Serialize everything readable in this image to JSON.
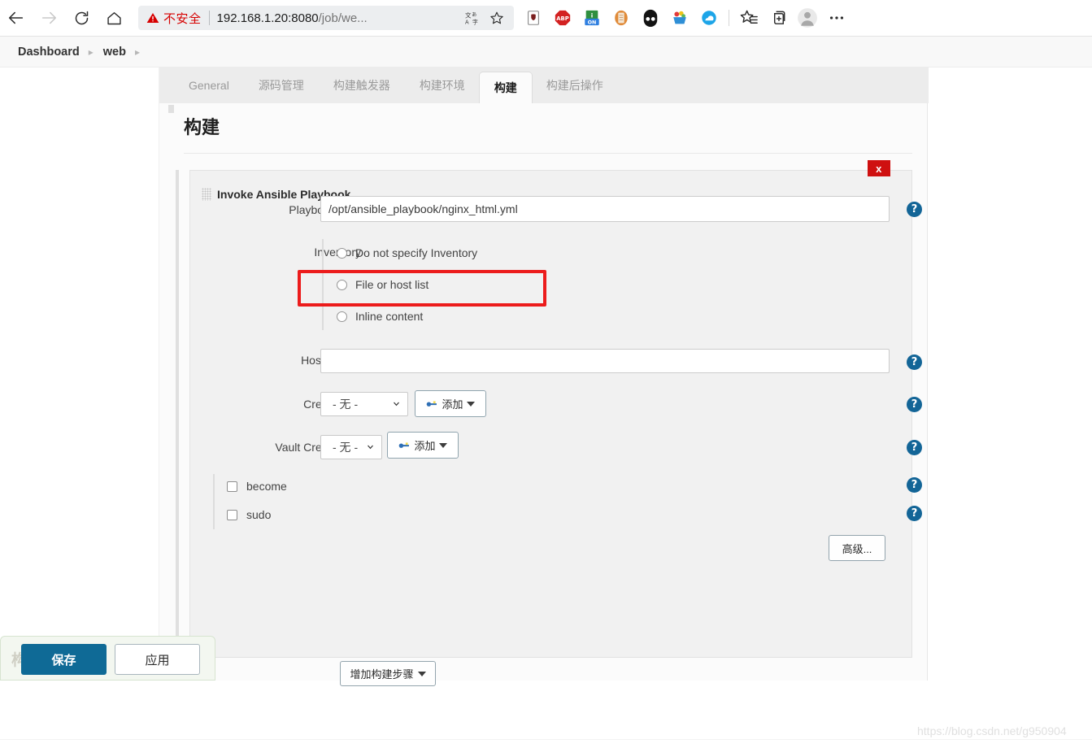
{
  "browser": {
    "back_icon": "arrow-left-icon",
    "forward_icon": "arrow-right-icon",
    "reload_icon": "reload-icon",
    "home_icon": "home-icon",
    "security_warning_icon": "warning-triangle-icon",
    "security_label": "不安全",
    "url_main": "192.168.1.20:8080",
    "url_path": "/job/we...",
    "translate_icon": "translate-icon",
    "favorite_icon": "star-icon",
    "extensions": [
      {
        "name": "shield-extension-icon",
        "title": "uBlock"
      },
      {
        "name": "abp-extension-icon",
        "title": "ABP"
      },
      {
        "name": "noscript-extension-icon",
        "title": "ON"
      },
      {
        "name": "document-extension-icon",
        "title": "Doc"
      },
      {
        "name": "panda-extension-icon",
        "title": "Panda"
      },
      {
        "name": "basket-extension-icon",
        "title": "Basket"
      },
      {
        "name": "cloud-extension-icon",
        "title": "OneDrive"
      }
    ],
    "collections_icon": "collections-icon",
    "add-tab_icon": "tab-add-icon",
    "profile_icon": "profile-avatar-icon",
    "more_icon": "more-ellipsis-icon"
  },
  "breadcrumb": {
    "items": [
      "Dashboard",
      "web"
    ],
    "separator": "▸"
  },
  "tabs": [
    {
      "label": "General",
      "active": false
    },
    {
      "label": "源码管理",
      "active": false
    },
    {
      "label": "构建触发器",
      "active": false
    },
    {
      "label": "构建环境",
      "active": false
    },
    {
      "label": "构建",
      "active": true
    },
    {
      "label": "构建后操作",
      "active": false
    }
  ],
  "section": {
    "title": "构建"
  },
  "builder": {
    "title": "Invoke Ansible Playbook",
    "close_label": "x",
    "help_label": "?",
    "playbook": {
      "label": "Playbook path",
      "value": "/opt/ansible_playbook/nginx_html.yml",
      "placeholder": ""
    },
    "inventory": {
      "label": "Inventory",
      "options": [
        {
          "label": "Do not specify Inventory",
          "checked": false
        },
        {
          "label": "File or host list",
          "checked": false
        },
        {
          "label": "Inline content",
          "checked": false
        }
      ]
    },
    "host_subset": {
      "label": "Host subset",
      "value": "",
      "placeholder": ""
    },
    "credentials": {
      "label": "Credentials",
      "selected": "- 无 -",
      "add_label": "添加"
    },
    "vault_credentials": {
      "label": "Vault Credentials",
      "selected": "- 无 -",
      "add_label": "添加"
    },
    "checkboxes": [
      {
        "label": "become",
        "checked": false
      },
      {
        "label": "sudo",
        "checked": false
      }
    ],
    "advanced_label": "高级..."
  },
  "add_build_step_label": "增加构建步骤",
  "savebar": {
    "ghost_char": "构",
    "save_label": "保存",
    "apply_label": "应用"
  },
  "watermark": "https://blog.csdn.net/g950904"
}
